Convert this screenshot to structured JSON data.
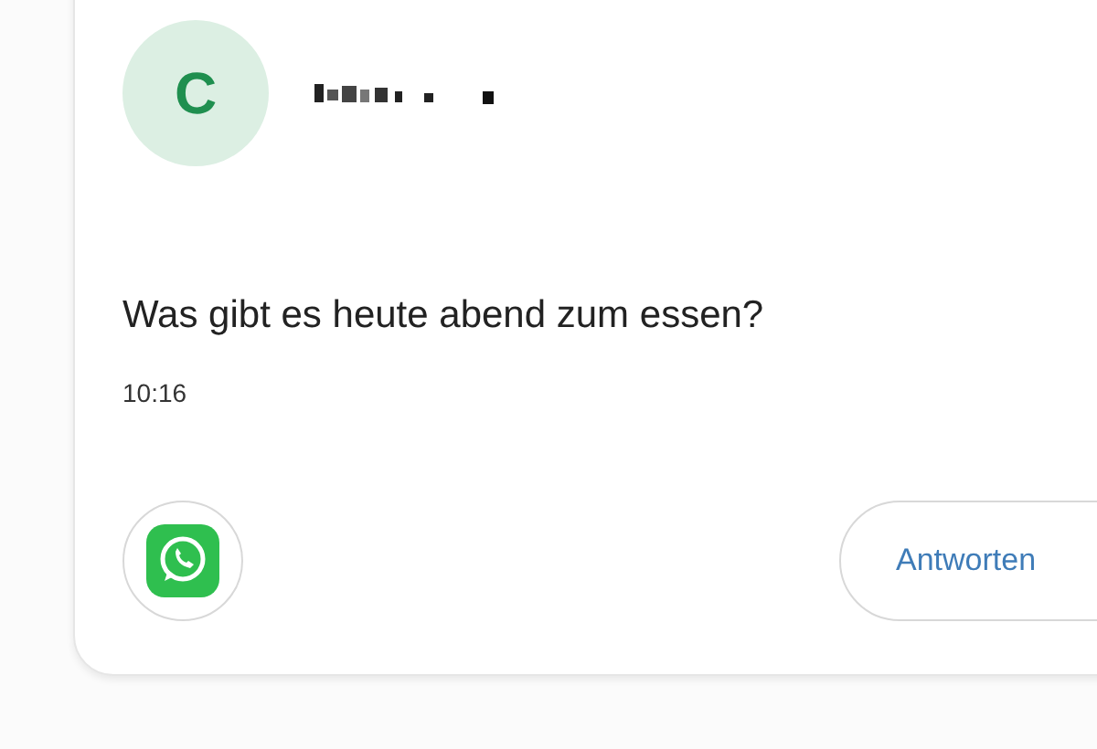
{
  "notification": {
    "avatar_letter": "C",
    "message": "Was gibt es heute abend zum essen?",
    "time": "10:16"
  },
  "actions": [
    {
      "kind": "app"
    },
    {
      "kind": "reply",
      "label": "Antworten"
    }
  ]
}
